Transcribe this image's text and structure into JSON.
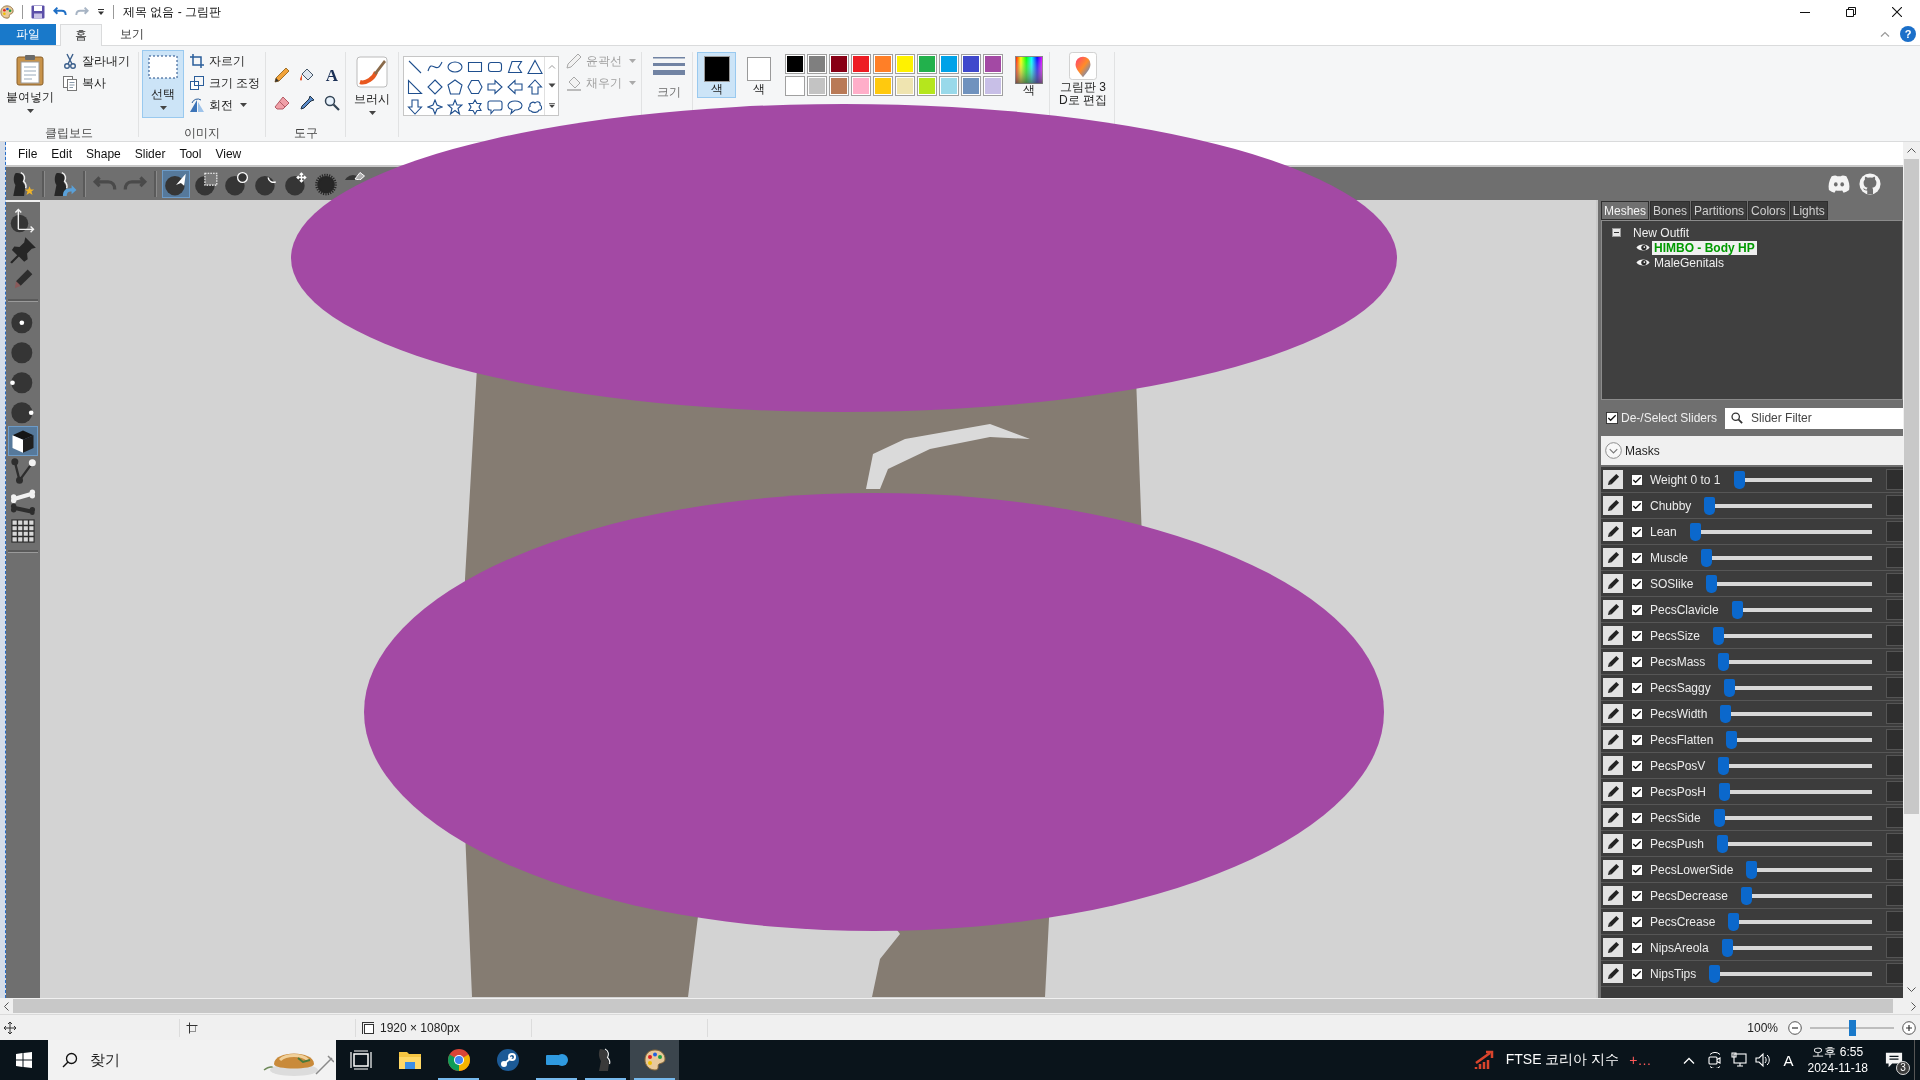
{
  "window": {
    "title": "제목 없음 - 그림판"
  },
  "ribbon_tabs": [
    {
      "label": "파일",
      "kind": "file",
      "selected": false
    },
    {
      "label": "홈",
      "kind": "tab",
      "selected": true
    },
    {
      "label": "보기",
      "kind": "tab",
      "selected": false
    }
  ],
  "help": "?",
  "ribbon": {
    "clipboard": {
      "label": "클립보드",
      "paste": "붙여넣기",
      "cut": "잘라내기",
      "copy": "복사"
    },
    "image": {
      "label": "이미지",
      "select": {
        "label": "선택",
        "selected": true
      },
      "crop": "자르기",
      "resize": "크기 조정",
      "rotate": "회전"
    },
    "tools": {
      "label": "도구",
      "text_tool": "A"
    },
    "brushes": "브러시",
    "shapes": {
      "outline": {
        "label": "윤곽선",
        "disabled": true
      },
      "fill": {
        "label": "채우기",
        "disabled": true
      }
    },
    "size": {
      "label": "크기",
      "disabled": true
    },
    "colors": [
      {
        "label": "색",
        "color": "#000000",
        "selected": true
      },
      {
        "label": "색",
        "color": "#ffffff",
        "selected": false
      }
    ],
    "palette": [
      {
        "color": "#000000"
      },
      {
        "color": "#7f7f7f"
      },
      {
        "color": "#880015"
      },
      {
        "color": "#ed1c24"
      },
      {
        "color": "#ff7f27"
      },
      {
        "color": "#fff200"
      },
      {
        "color": "#22b14c"
      },
      {
        "color": "#00a2e8"
      },
      {
        "color": "#3f48cc"
      },
      {
        "color": "#a349a4"
      },
      {
        "color": "#ffffff"
      },
      {
        "color": "#c3c3c3"
      },
      {
        "color": "#b97a57"
      },
      {
        "color": "#ffaec9"
      },
      {
        "color": "#ffc90e"
      },
      {
        "color": "#efe4b0"
      },
      {
        "color": "#b5e61d"
      },
      {
        "color": "#99d9ea"
      },
      {
        "color": "#7092be"
      },
      {
        "color": "#c8bfe7"
      }
    ],
    "edit_colors": "색",
    "paint3d": [
      "그림판 3",
      "D로 편집"
    ]
  },
  "studio": {
    "menu": [
      "File",
      "Edit",
      "Shape",
      "Slider",
      "Tool",
      "View"
    ],
    "toolbar": [
      {
        "kind": "reference",
        "selected": false,
        "disabled": false
      },
      {
        "kind": "outfit",
        "selected": false,
        "disabled": false
      },
      {
        "kind": "undo",
        "selected": false,
        "disabled": true
      },
      {
        "kind": "redo",
        "selected": false,
        "disabled": true
      },
      {
        "kind": "select",
        "selected": true,
        "disabled": false
      },
      {
        "kind": "mask",
        "selected": false,
        "disabled": false
      },
      {
        "kind": "inflate",
        "selected": false,
        "disabled": false
      },
      {
        "kind": "deflate",
        "selected": false,
        "disabled": false
      },
      {
        "kind": "move",
        "selected": false,
        "disabled": false
      },
      {
        "kind": "smooth",
        "selected": false,
        "disabled": false
      },
      {
        "kind": "erase",
        "selected": false,
        "disabled": false
      }
    ],
    "side_tools": [
      {
        "kind": "axes",
        "selected": false
      },
      {
        "kind": "pin",
        "selected": false
      },
      {
        "kind": "pen",
        "selected": false
      },
      {
        "kind": "ball-center",
        "selected": false
      },
      {
        "kind": "ball",
        "selected": false
      },
      {
        "kind": "ball-left",
        "selected": false
      },
      {
        "kind": "ball-right",
        "selected": false
      },
      {
        "kind": "cube",
        "selected": true
      },
      {
        "kind": "vertex",
        "selected": false
      },
      {
        "kind": "bones",
        "selected": false
      },
      {
        "kind": "grid",
        "selected": false
      }
    ],
    "links": [
      {
        "kind": "discord"
      },
      {
        "kind": "github"
      }
    ],
    "panel": {
      "tabs": [
        {
          "label": "Meshes",
          "selected": true
        },
        {
          "label": "Bones",
          "selected": false
        },
        {
          "label": "Partitions",
          "selected": false
        },
        {
          "label": "Colors",
          "selected": false
        },
        {
          "label": "Lights",
          "selected": false
        }
      ],
      "tree": [
        {
          "label": "New Outfit",
          "expanded": true,
          "selected": false,
          "children": [
            {
              "label": "HIMBO - Body HP",
              "selected": true,
              "visible": true
            },
            {
              "label": "MaleGenitals",
              "selected": false,
              "visible": true
            }
          ]
        }
      ],
      "select_all": {
        "label": "De-/Select Sliders",
        "checked": true
      },
      "filter": {
        "placeholder": "Slider Filter"
      },
      "group": {
        "label": "Masks"
      },
      "sliders": [
        {
          "name": "Weight 0 to 1",
          "checked": true,
          "level": 0
        },
        {
          "name": "Chubby",
          "checked": true,
          "level": 0
        },
        {
          "name": "Lean",
          "checked": true,
          "level": 0
        },
        {
          "name": "Muscle",
          "checked": true,
          "level": 0
        },
        {
          "name": "SOSlike",
          "checked": true,
          "level": 0
        },
        {
          "name": "PecsClavicle",
          "checked": true,
          "level": 0
        },
        {
          "name": "PecsSize",
          "checked": true,
          "level": 0
        },
        {
          "name": "PecsMass",
          "checked": true,
          "level": 0
        },
        {
          "name": "PecsSaggy",
          "checked": true,
          "level": 0
        },
        {
          "name": "PecsWidth",
          "checked": true,
          "level": 0
        },
        {
          "name": "PecsFlatten",
          "checked": true,
          "level": 0
        },
        {
          "name": "PecsPosV",
          "checked": true,
          "level": 0
        },
        {
          "name": "PecsPosH",
          "checked": true,
          "level": 0
        },
        {
          "name": "PecsSide",
          "checked": true,
          "level": 0
        },
        {
          "name": "PecsPush",
          "checked": true,
          "level": 0
        },
        {
          "name": "PecsLowerSide",
          "checked": true,
          "level": 0
        },
        {
          "name": "PecsDecrease",
          "checked": true,
          "level": 0
        },
        {
          "name": "PecsCrease",
          "checked": true,
          "level": 0
        },
        {
          "name": "NipsAreola",
          "checked": true,
          "level": 0
        },
        {
          "name": "NipsTips",
          "checked": true,
          "level": 0
        }
      ]
    }
  },
  "status_bar": {
    "canvas_size": "1920 × 1080px",
    "zoom": "100%",
    "zoom_slider": {
      "level": 0.5
    }
  },
  "taskbar": {
    "search": {
      "placeholder": "찾기"
    },
    "apps": [
      {
        "kind": "task-view",
        "open": false,
        "active": false
      },
      {
        "kind": "explorer",
        "open": false,
        "active": false
      },
      {
        "kind": "browser",
        "open": true,
        "active": false
      },
      {
        "kind": "steam",
        "open": false,
        "active": false
      },
      {
        "kind": "app",
        "open": true,
        "active": false
      },
      {
        "kind": "studio",
        "open": true,
        "active": false
      },
      {
        "kind": "paint",
        "open": true,
        "active": true
      }
    ],
    "widget": {
      "label": "FTSE 코리아 지수",
      "change": "+…"
    },
    "ime": "A",
    "time": "오후 6:55",
    "date": "2024-11-18",
    "notifications": "3"
  }
}
